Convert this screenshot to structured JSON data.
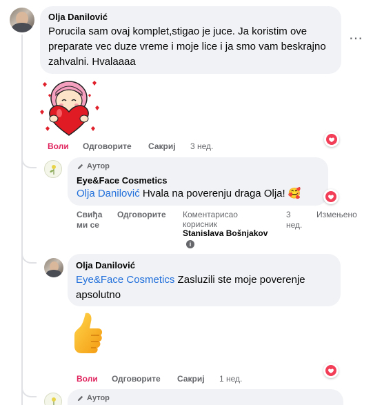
{
  "comments": [
    {
      "author": "Olja Danilović",
      "text": "Porucila sam ovaj komplet,stigao je juce. Ja koristim ove preparate vec duze vreme i moje lice i ja smo vam beskrajno zahvalni. Hvalaaaa",
      "actions": {
        "like": "Воли",
        "reply": "Одговорите",
        "hide": "Сакриј"
      },
      "time": "3 нед.",
      "more_icon": "⋯",
      "sticker": "girl-heart-sticker"
    },
    {
      "author_badge": "Аутор",
      "author": "Eye&Face Cosmetics",
      "mention": "Olja Danilović",
      "text": " Hvala na poverenju draga Olja! 🥰",
      "actions": {
        "like": "Свиђа ми се",
        "reply": "Одговорите"
      },
      "commented_by_label": "Коментарисао корисник",
      "commented_by_name": "Stanislava Bošnjakov",
      "time": "3 нед.",
      "edited": "Измењено",
      "info_icon": "i"
    },
    {
      "author": "Olja Danilović",
      "mention": "Eye&Face Cosmetics",
      "text": " Zasluzili ste moje poverenje apsolutno",
      "actions": {
        "like": "Воли",
        "reply": "Одговорите",
        "hide": "Сакриј"
      },
      "time": "1 нед.",
      "sticker": "thumbs-up-sticker"
    },
    {
      "author_badge": "Аутор"
    }
  ],
  "colors": {
    "like_red": "#e0245e",
    "mention_blue": "#216fdb",
    "bubble_gray": "#f0f2f5"
  }
}
